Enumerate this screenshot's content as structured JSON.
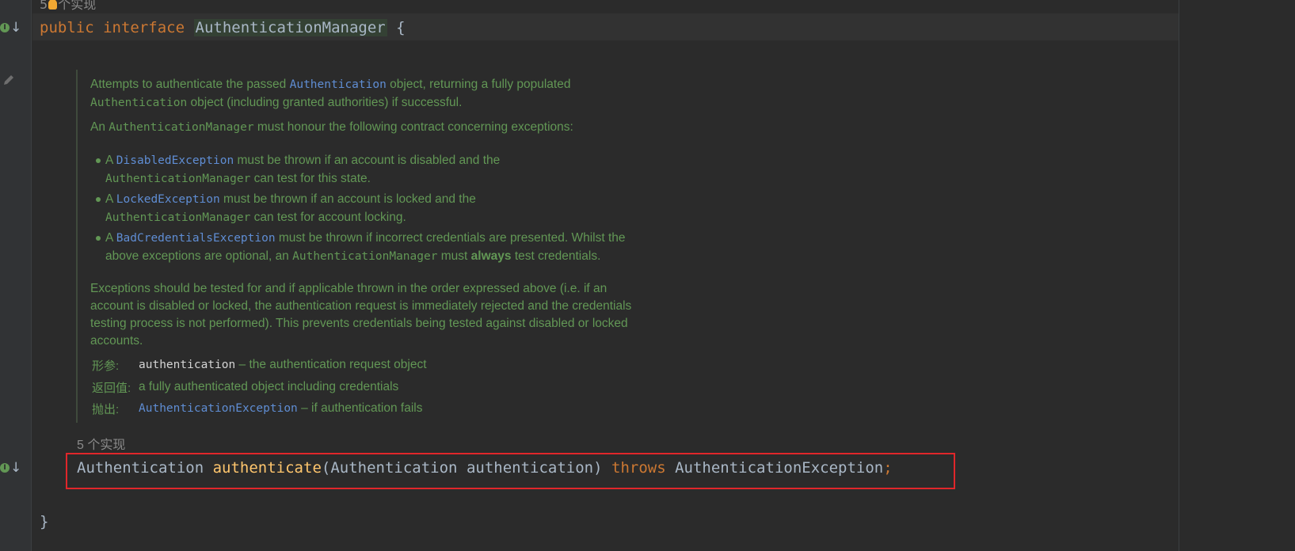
{
  "top_hint": {
    "prefix": "5",
    "suffix": "个实现"
  },
  "line1": {
    "kw_public": "public",
    "kw_interface": "interface",
    "class_name": "AuthenticationManager",
    "brace": "{"
  },
  "doc": {
    "p1_a": "Attempts to authenticate the passed ",
    "p1_link": "Authentication",
    "p1_b": " object, returning a fully populated",
    "p1_c_code": "Authentication",
    "p1_c": " object (including granted authorities) if successful.",
    "p2_a": "An ",
    "p2_code": "AuthenticationManager",
    "p2_b": " must honour the following contract concerning exceptions:",
    "bullets": [
      {
        "a": "A ",
        "link": "DisabledException",
        "b": " must be thrown if an account is disabled and the",
        "c_code": "AuthenticationManager",
        "c": " can test for this state."
      },
      {
        "a": "A ",
        "link": "LockedException",
        "b": " must be thrown if an account is locked and the",
        "c_code": "AuthenticationManager",
        "c": " can test for account locking."
      },
      {
        "a": "A ",
        "link": "BadCredentialsException",
        "b": " must be thrown if incorrect credentials are presented. Whilst the",
        "c_pre": "above exceptions are optional, an ",
        "c_code": "AuthenticationManager",
        "c_mid": " must ",
        "c_bold": "always",
        "c": " test credentials."
      }
    ],
    "p3_lines": [
      "Exceptions should be tested for and if applicable thrown in the order expressed above (i.e. if an",
      "account is disabled or locked, the authentication request is immediately rejected and the credentials",
      "testing process is not performed). This prevents credentials being tested against disabled or locked",
      "accounts."
    ],
    "param_label": "形参:",
    "param_code": "authentication",
    "param_desc": " – the authentication request object",
    "return_label": "返回值:",
    "return_desc": "a fully authenticated object including credentials",
    "throws_label": "抛出:",
    "throws_link": "AuthenticationException",
    "throws_desc": " – if authentication fails"
  },
  "impl_hint": "5 个实现",
  "method": {
    "ret_type": "Authentication",
    "name": "authenticate",
    "open": "(",
    "param_type": "Authentication",
    "param_name": "authentication",
    "close": ")",
    "kw_throws": "throws",
    "exception": "AuthenticationException",
    "semi": ";"
  },
  "closing_brace": "}",
  "colors": {
    "background": "#2b2b2b",
    "keyword": "#cc7832",
    "method": "#ffc66d",
    "doc": "#629755",
    "link": "#5f8dd3",
    "highlight_box": "#e0262a"
  }
}
